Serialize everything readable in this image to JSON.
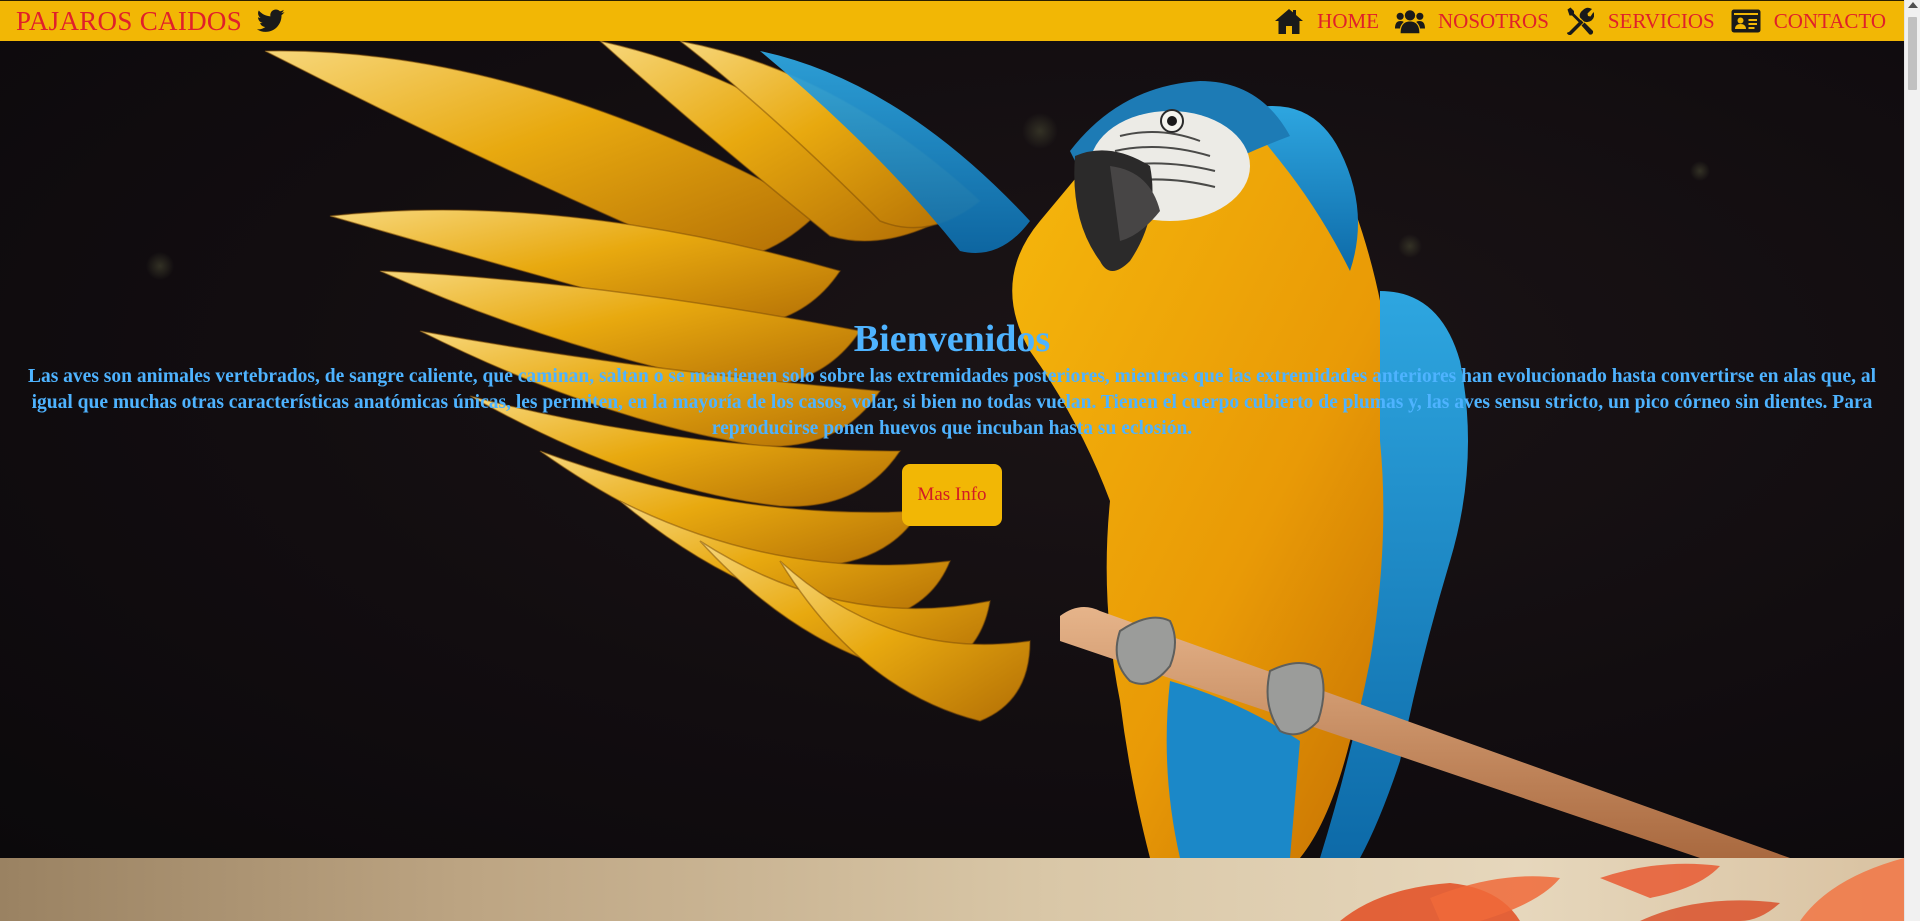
{
  "header": {
    "brand": "PAJAROS CAIDOS",
    "brand_icon": "twitter-bird-icon",
    "nav": [
      {
        "label": "HOME",
        "icon": "home-icon"
      },
      {
        "label": "NOSOTROS",
        "icon": "users-icon"
      },
      {
        "label": "SERVICIOS",
        "icon": "tools-icon"
      },
      {
        "label": "CONTACTO",
        "icon": "address-card-icon"
      }
    ]
  },
  "hero": {
    "title": "Bienvenidos",
    "description": "Las aves son animales vertebrados, de sangre caliente, que caminan, saltan o se mantienen solo sobre las extremidades posteriores, mientras que las extremidades anteriores han evolucionado hasta convertirse en alas que, al igual que muchas otras características anatómicas únicas, les permiten, en la mayoría de los casos, volar, si bien no todas vuelan. Tienen el cuerpo cubierto de plumas y, las aves sensu stricto, un pico córneo sin dientes. Para reproducirse ponen huevos que incuban hasta su eclosión.",
    "button": "Mas Info",
    "image": "macaw-parrot-photo"
  },
  "colors": {
    "header_bg": "#f2b705",
    "header_text": "#e0202a",
    "hero_text": "#4eb3ff",
    "button_bg": "#f2b705",
    "button_text": "#d21c24"
  }
}
